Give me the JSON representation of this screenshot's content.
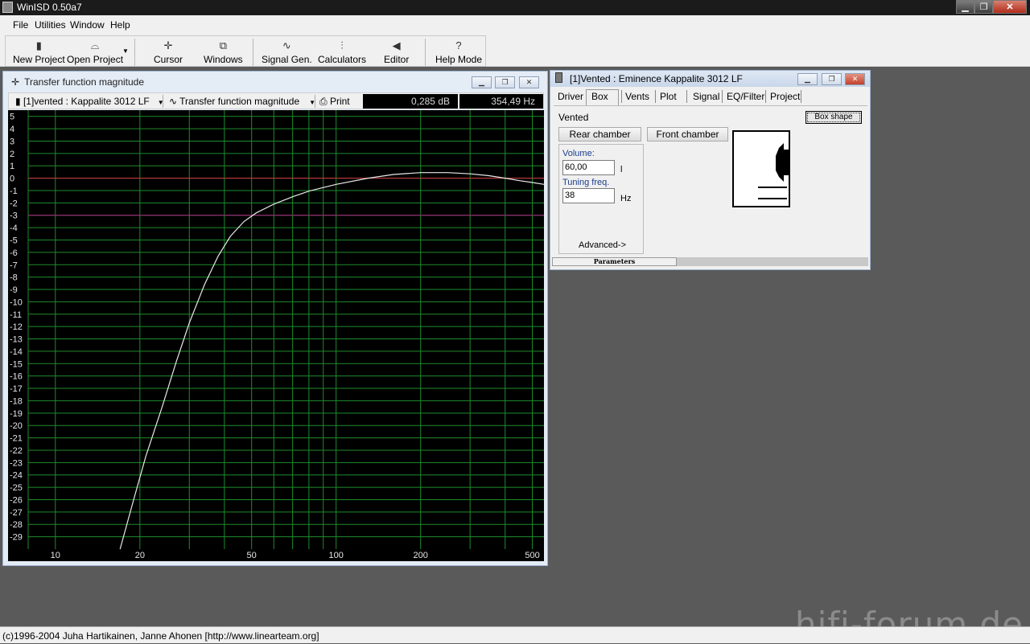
{
  "app": {
    "title": "WinISD 0.50a7"
  },
  "menu": [
    "File",
    "Utilities",
    "Window",
    "Help"
  ],
  "toolbar": {
    "new_project": "New Project",
    "open_project": "Open Project",
    "cursor": "Cursor",
    "windows": "Windows",
    "signal_gen": "Signal Gen.",
    "calculators": "Calculators",
    "editor": "Editor",
    "help_mode": "Help Mode"
  },
  "plot_window": {
    "title": "Transfer function magnitude",
    "project_select": "[1]vented : Kappalite 3012 LF",
    "graph_select": "Transfer function magnitude",
    "print": "Print",
    "readout_db": "0,285 dB",
    "readout_hz": "354,49 Hz"
  },
  "chart_data": {
    "type": "line",
    "title": "",
    "xlabel": "",
    "ylabel": "",
    "xscale": "log",
    "xlim": [
      8,
      550
    ],
    "ylim": [
      -30,
      5.5
    ],
    "x_tick_labels": [
      "10",
      "20",
      "50",
      "100",
      "200",
      "500"
    ],
    "y_tick_labels": [
      "5",
      "4",
      "3",
      "2",
      "1",
      "0",
      "-1",
      "-2",
      "-3",
      "-4",
      "-5",
      "-6",
      "-7",
      "-8",
      "-9",
      "-10",
      "-11",
      "-12",
      "-13",
      "-14",
      "-15",
      "-16",
      "-17",
      "-18",
      "-19",
      "-20",
      "-21",
      "-22",
      "-23",
      "-24",
      "-25",
      "-26",
      "-27",
      "-28",
      "-29"
    ],
    "grid": true,
    "reference_lines": [
      {
        "y": 0,
        "color": "#d03040"
      },
      {
        "y": -3,
        "color": "#b02080"
      }
    ],
    "series": [
      {
        "color": "#e8e8e8",
        "x": [
          17,
          19,
          21,
          24,
          27,
          30,
          34,
          38,
          42,
          47,
          52,
          60,
          70,
          80,
          100,
          130,
          160,
          200,
          250,
          300,
          350,
          400,
          450,
          500,
          550
        ],
        "y": [
          -30,
          -26,
          -22.5,
          -18.5,
          -14.8,
          -11.7,
          -8.6,
          -6.3,
          -4.7,
          -3.5,
          -2.8,
          -2.1,
          -1.5,
          -1.05,
          -0.5,
          0,
          0.3,
          0.45,
          0.45,
          0.35,
          0.2,
          0,
          -0.2,
          -0.35,
          -0.5
        ]
      }
    ]
  },
  "box_window": {
    "title": "[1]Vented : Eminence Kappalite 3012 LF",
    "tabs": [
      "Driver",
      "Box",
      "Vents",
      "Plot",
      "Signal",
      "EQ/Filter",
      "Project"
    ],
    "box_type": "Vented",
    "box_shape_button": "Box shape",
    "rear_chamber": "Rear chamber",
    "front_chamber": "Front chamber",
    "volume_label": "Volume:",
    "volume_value": "60,00",
    "volume_unit": "l",
    "tuning_label": "Tuning freq.",
    "tuning_value": "38",
    "tuning_unit": "Hz",
    "advanced": "Advanced->",
    "bottom_tab": "Parameters"
  },
  "status": "(c)1996-2004 Juha Hartikainen, Janne Ahonen [http://www.linearteam.org]",
  "watermark": "hifi-forum.de"
}
